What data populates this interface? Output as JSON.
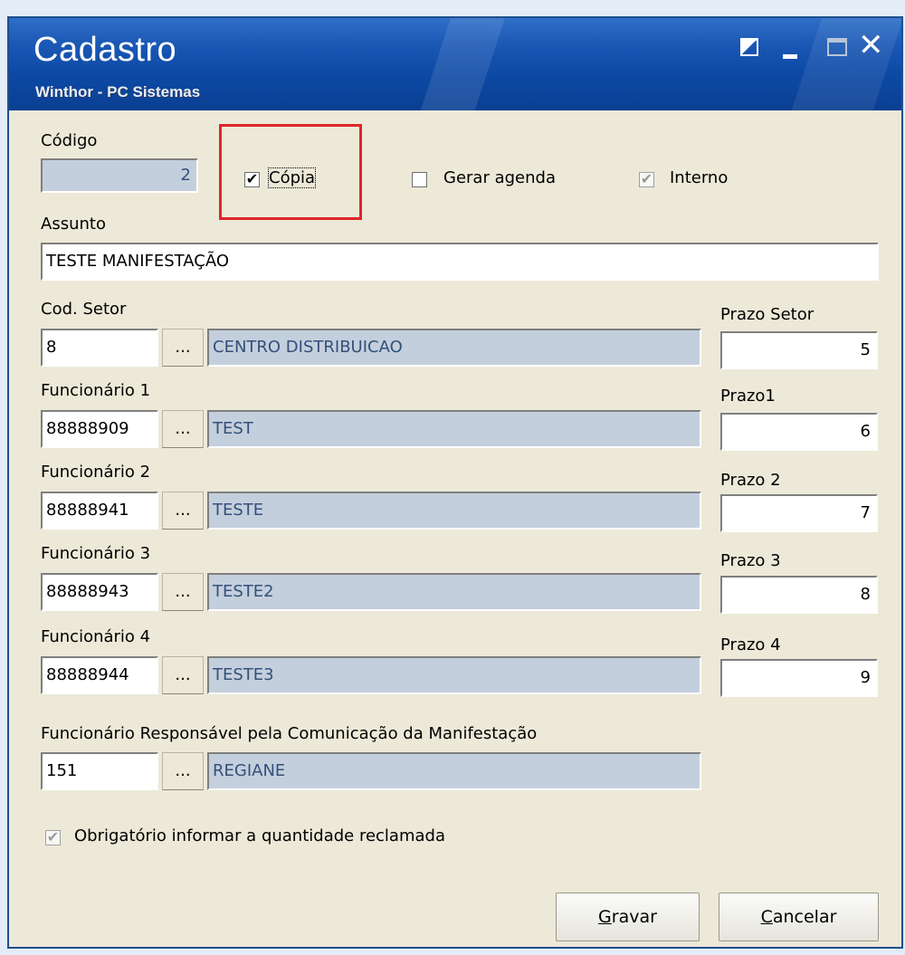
{
  "window": {
    "title": "Cadastro",
    "subtitle": "Winthor - PC Sistemas",
    "close_glyph": "✕"
  },
  "form": {
    "codigo": {
      "label": "Código",
      "value": "2"
    },
    "copia": {
      "label": "Cópia",
      "checked": true
    },
    "gerar_agenda": {
      "label": "Gerar agenda",
      "checked": false
    },
    "interno": {
      "label": "Interno",
      "checked": true,
      "enabled": false
    },
    "assunto": {
      "label": "Assunto",
      "value": "TESTE MANIFESTAÇÃO"
    },
    "setor": {
      "label": "Cod. Setor",
      "code": "8",
      "name": "CENTRO DISTRIBUICAO",
      "prazo_label": "Prazo Setor",
      "prazo": "5"
    },
    "func1": {
      "label": "Funcionário 1",
      "code": "88888909",
      "name": "TEST",
      "prazo_label": "Prazo1",
      "prazo": "6"
    },
    "func2": {
      "label": "Funcionário 2",
      "code": "88888941",
      "name": "TESTE",
      "prazo_label": "Prazo 2",
      "prazo": "7"
    },
    "func3": {
      "label": "Funcionário 3",
      "code": "88888943",
      "name": "TESTE2",
      "prazo_label": "Prazo 3",
      "prazo": "8"
    },
    "func4": {
      "label": "Funcionário 4",
      "code": "88888944",
      "name": "TESTE3",
      "prazo_label": "Prazo 4",
      "prazo": "9"
    },
    "responsavel": {
      "label": "Funcionário Responsável pela Comunicação da Manifestação",
      "code": "151",
      "name": "REGIANE"
    },
    "obrigatorio": {
      "label": "Obrigatório informar a quantidade reclamada",
      "checked": true,
      "enabled": false
    },
    "lookup_button": "...",
    "check_glyph": "✔"
  },
  "buttons": {
    "gravar_first": "G",
    "gravar_rest": "ravar",
    "cancelar_first": "C",
    "cancelar_rest": "ancelar"
  },
  "colors": {
    "highlight": "#e0252b",
    "titlebar": "#1b58b5",
    "readonly_field": "#c4cfdd"
  }
}
